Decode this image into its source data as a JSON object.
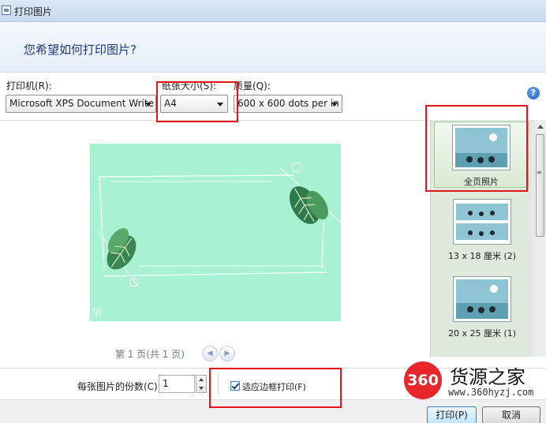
{
  "window": {
    "title": "打印图片"
  },
  "header": {
    "heading": "您希望如何打印图片?"
  },
  "options": {
    "printer_label": "打印机(R):",
    "printer_value": "Microsoft XPS Document Write",
    "paper_size_label": "纸张大小(S):",
    "paper_size_value": "A4",
    "quality_label": "质量(Q):",
    "quality_value": "600 x 600 dots per in"
  },
  "preview": {
    "pager_text": "第 1 页(共 1 页)",
    "corner_glyph": "阴"
  },
  "layouts": [
    {
      "caption": "全页照片",
      "selected": true
    },
    {
      "caption": "13 x 18 厘米 (2)",
      "selected": false
    },
    {
      "caption": "20 x 25 厘米 (1)",
      "selected": false
    }
  ],
  "bottom": {
    "copies_label": "每张图片的份数(C):",
    "copies_value": "1",
    "fit_label": "适应边框打印(F)",
    "fit_checked": true,
    "print_button": "打印(P)",
    "cancel_button": "取消"
  },
  "watermark": {
    "logo": "360",
    "name": "货源之家",
    "url": "www.360hyzj.com"
  },
  "colors": {
    "annotation": "#e3151b",
    "preview_bg": "#a8f1d3",
    "heading": "#1f3d7a"
  }
}
